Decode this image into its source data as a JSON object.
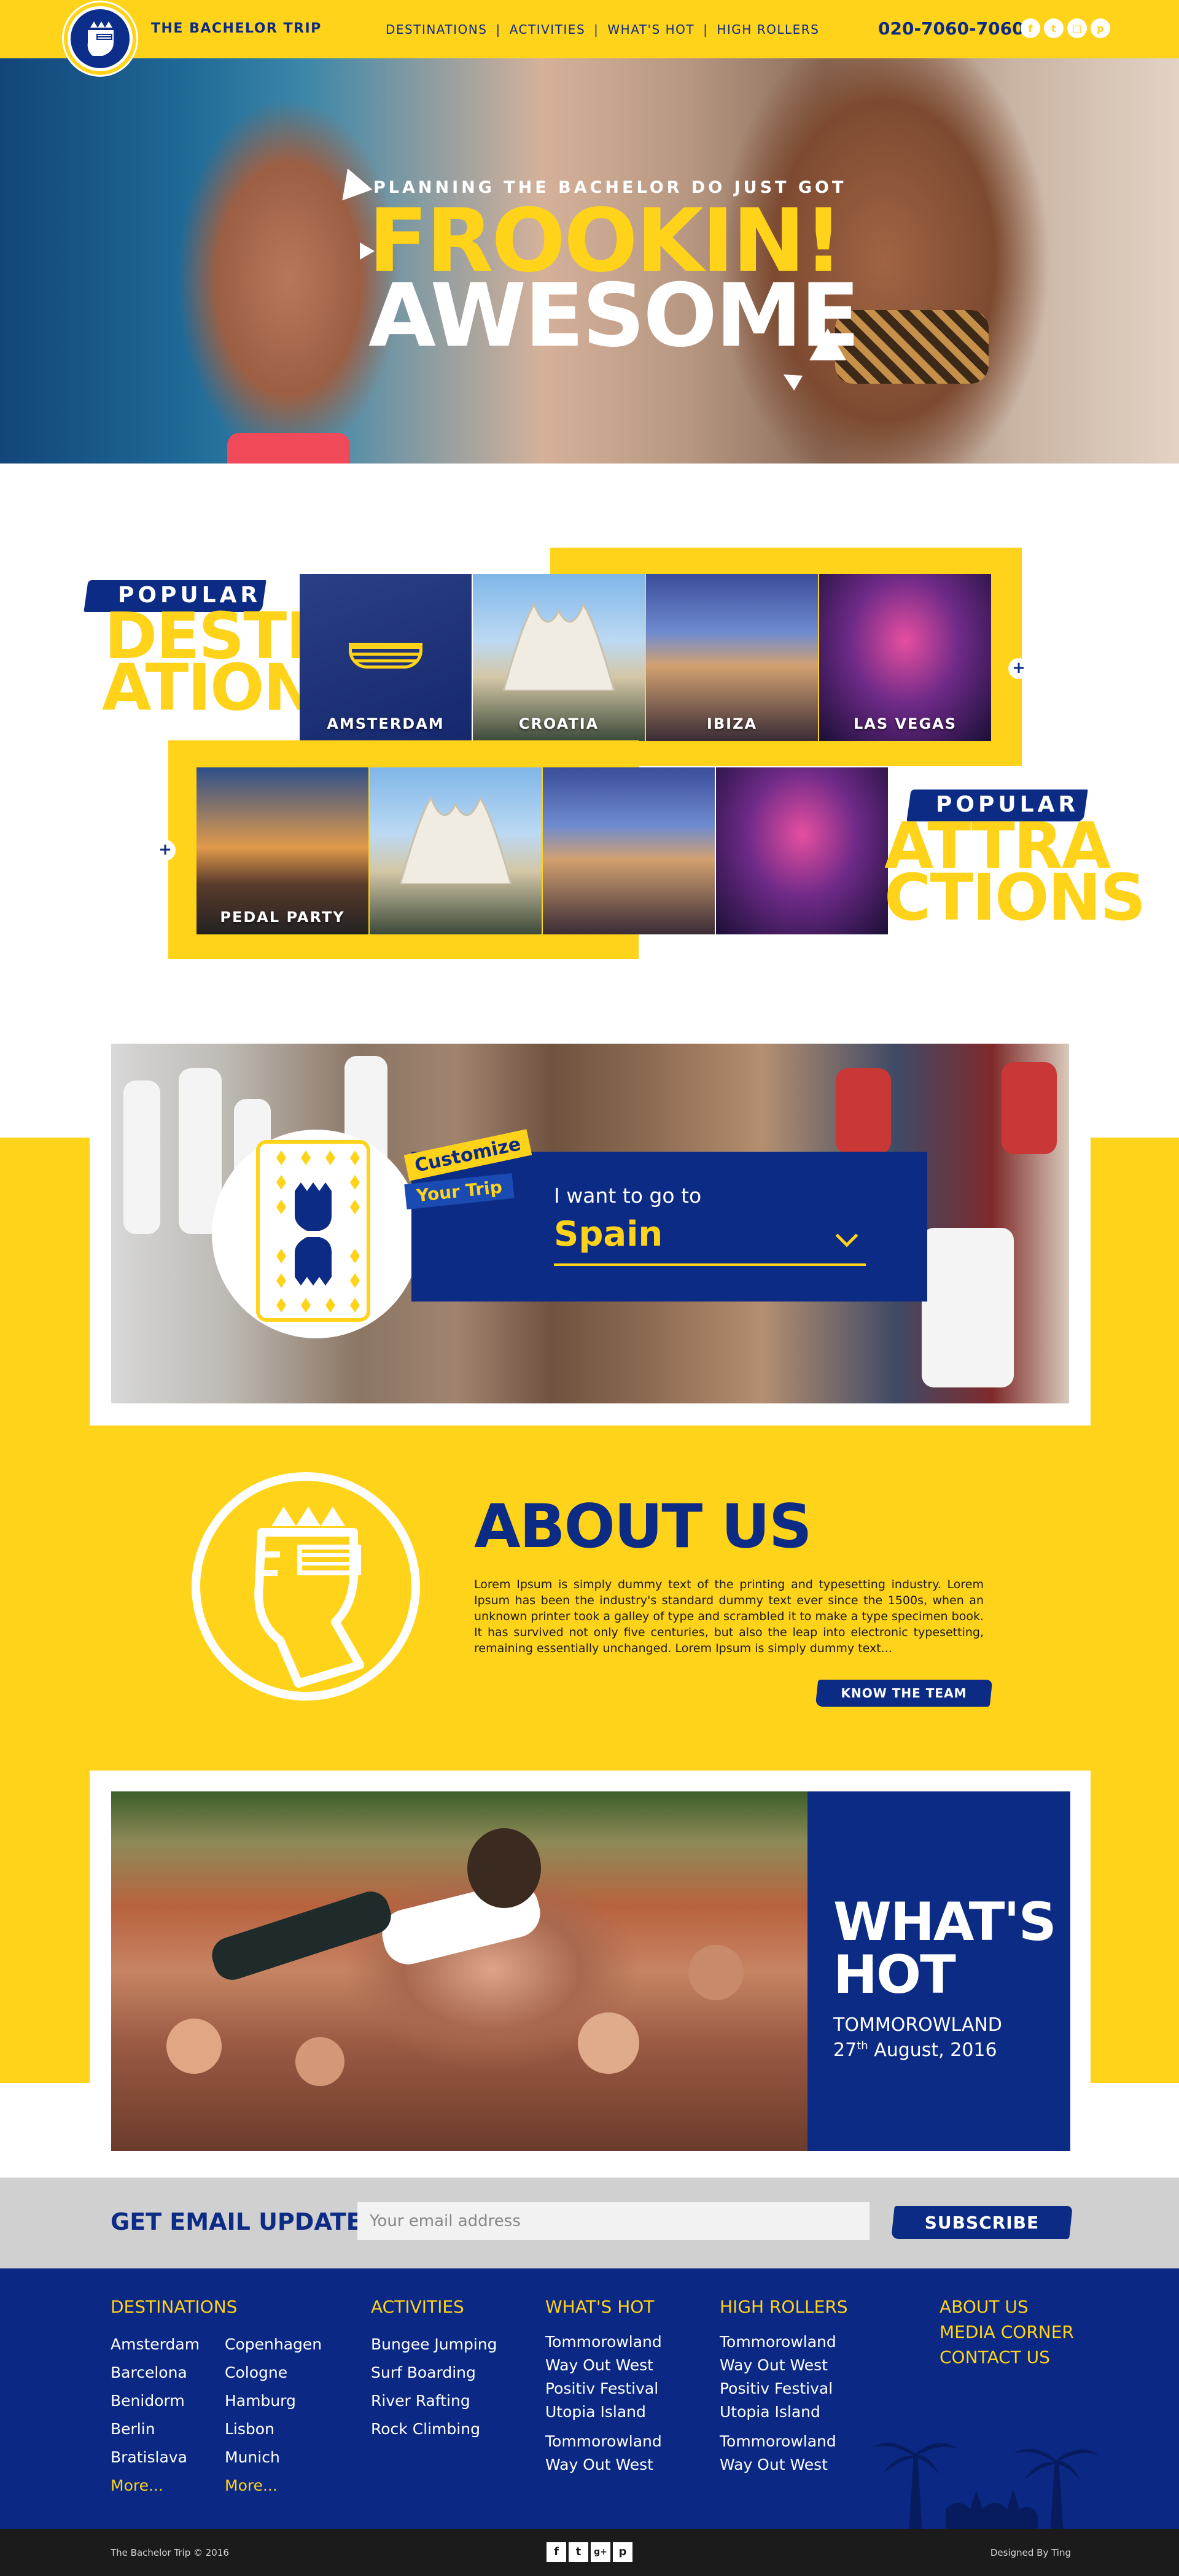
{
  "header": {
    "brand": "THE BACHELOR TRIP",
    "nav": [
      "DESTINATIONS",
      "ACTIVITIES",
      "WHAT'S HOT",
      "HIGH ROLLERS"
    ],
    "separator": "|",
    "phone": "020-7060-7060",
    "social_icons": [
      "facebook-icon",
      "twitter-icon",
      "instagram-icon",
      "pinterest-icon"
    ]
  },
  "hero": {
    "subtitle": "PLANNING THE BACHELOR DO JUST GOT",
    "line1": "FROOKIN!",
    "line2": "AWESOME"
  },
  "destinations": {
    "tag": "POPULAR",
    "title_line1": "DESTIN",
    "title_line2": "ATIONS",
    "items": [
      "AMSTERDAM",
      "CROATIA",
      "IBIZA",
      "LAS VEGAS"
    ],
    "more": "+"
  },
  "attractions": {
    "tag": "POPULAR",
    "title_line1": "ATTRA",
    "title_line2": "CTIONS",
    "items": [
      "PEDAL PARTY",
      "",
      "",
      ""
    ],
    "more": "+"
  },
  "customize": {
    "tag1": "Customize",
    "tag2": "Your Trip",
    "label": "I want to go to",
    "value": "Spain"
  },
  "about": {
    "title": "ABOUT US",
    "body": "Lorem Ipsum is simply dummy text of the printing and typesetting industry. Lorem Ipsum has been the industry's standard dummy text ever since the 1500s, when an unknown printer took a galley of type and scrambled it to make a type specimen book. It has survived not only five centuries, but also the leap into electronic typesetting, remaining essentially unchanged. Lorem Ipsum is simply dummy text...",
    "button": "KNOW THE TEAM"
  },
  "whats_hot": {
    "title_line1": "WHAT'S",
    "title_line2": "HOT",
    "event": "TOMMOROWLAND",
    "date_day": "27",
    "date_suffix": "th",
    "date_rest": " August, 2016"
  },
  "email": {
    "label": "GET EMAIL UPDATE",
    "placeholder": "Your email address",
    "button": "SUBSCRIBE"
  },
  "footer": {
    "destinations": {
      "head": "DESTINATIONS",
      "col1": [
        "Amsterdam",
        "Barcelona",
        "Benidorm",
        "Berlin",
        "Bratislava",
        "More..."
      ],
      "col2": [
        "Copenhagen",
        "Cologne",
        "Hamburg",
        "Lisbon",
        "Munich",
        "More..."
      ]
    },
    "activities": {
      "head": "ACTIVITIES",
      "items": [
        "Bungee Jumping",
        "Surf Boarding",
        "River Rafting",
        "Rock Climbing"
      ]
    },
    "whats_hot": {
      "head": "WHAT'S HOT",
      "items": [
        "Tommorowland",
        "Way Out West",
        "Positiv Festival",
        "Utopia Island",
        "Tommorowland",
        "Way Out West"
      ]
    },
    "high_rollers": {
      "head": "HIGH ROLLERS",
      "items": [
        "Tommorowland",
        "Way Out West",
        "Positiv Festival",
        "Utopia Island",
        "Tommorowland",
        "Way Out West"
      ]
    },
    "links": [
      "ABOUT US",
      "MEDIA CORNER",
      "CONTACT US"
    ]
  },
  "bottom": {
    "copyright": "The Bachelor Trip © 2016",
    "designed": "Designed By Ting",
    "social_icons": [
      "facebook-icon",
      "twitter-icon",
      "google-plus-icon",
      "pinterest-icon"
    ]
  },
  "colors": {
    "yellow": "#ffd319",
    "navy": "#0c2b84",
    "footer": "#0a2884"
  }
}
